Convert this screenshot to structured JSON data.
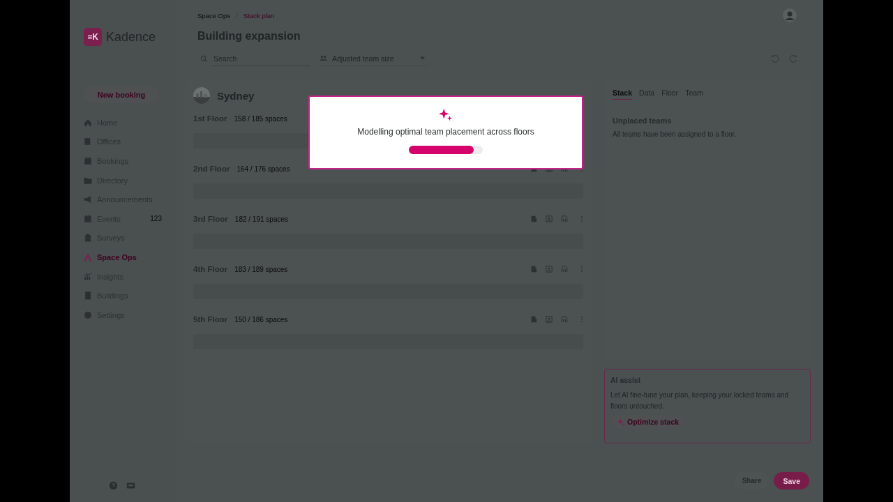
{
  "sidebar": {
    "logo_mark": "≡K",
    "logo_text": "Kadence",
    "new_booking": "New booking",
    "items": [
      {
        "label": "Home",
        "selected": false
      },
      {
        "label": "Offices",
        "selected": false
      },
      {
        "label": "Bookings",
        "selected": false
      },
      {
        "label": "Directory",
        "selected": false
      },
      {
        "label": "Announcements",
        "selected": false
      },
      {
        "label": "Events",
        "selected": false,
        "badge": "123"
      },
      {
        "label": "Surveys",
        "selected": false
      },
      {
        "label": "Space Ops",
        "selected": true
      },
      {
        "label": "Insights",
        "selected": false
      },
      {
        "label": "Buildings",
        "selected": false
      },
      {
        "label": "Settings",
        "selected": false
      }
    ]
  },
  "breadcrumb": [
    {
      "label": "Space Ops",
      "current": false
    },
    {
      "label": "Stack plan",
      "current": true
    }
  ],
  "title": "Building expansion",
  "search": {
    "placeholder": "Search"
  },
  "filter": {
    "placeholder": "Adjusted team size"
  },
  "location": "Sydney",
  "floors": [
    {
      "name": "1st Floor",
      "spaces": "158 / 185 spaces"
    },
    {
      "name": "2nd Floor",
      "spaces": "164 / 176 spaces"
    },
    {
      "name": "3rd Floor",
      "spaces": "182 / 191 spaces"
    },
    {
      "name": "4th Floor",
      "spaces": "183 / 189 spaces"
    },
    {
      "name": "5th Floor",
      "spaces": "150 / 186 spaces"
    }
  ],
  "modal": {
    "message": "Modelling optimal team placement across floors",
    "level": 0.88
  },
  "tabs": [
    {
      "label": "Stack",
      "selected": true
    },
    {
      "label": "Data",
      "selected": false
    },
    {
      "label": "Floor",
      "selected": false
    },
    {
      "label": "Team",
      "selected": false
    }
  ],
  "unplaced": {
    "heading": "Unplaced teams",
    "text": "All teams have been assigned to a floor."
  },
  "ai_assist": {
    "title": "AI assist",
    "text": "Let AI fine-tune your plan, keeping your locked teams and floors untouched.",
    "button": "Optimize stack"
  },
  "footer": {
    "share": "Share",
    "save": "Save"
  }
}
